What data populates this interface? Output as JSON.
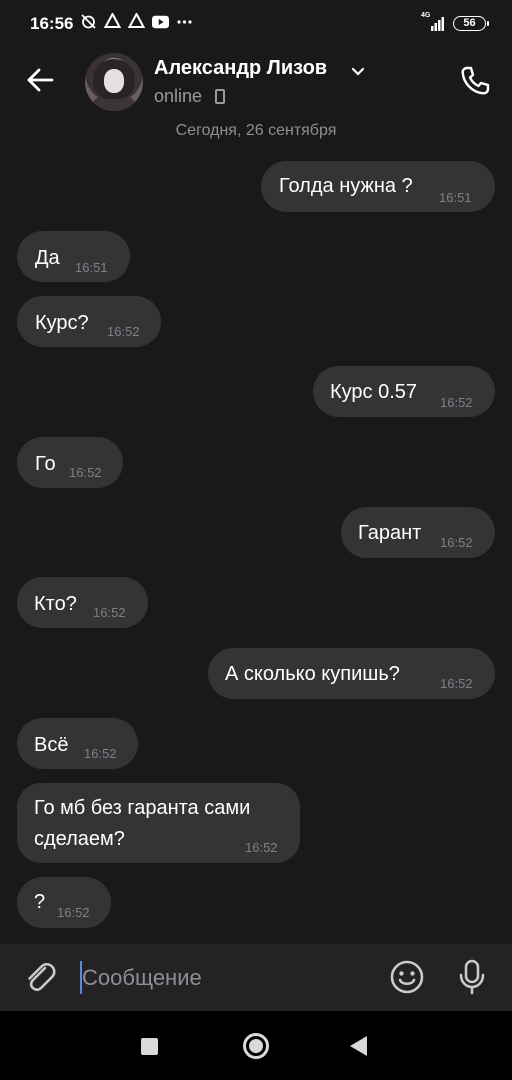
{
  "status_bar": {
    "time": "16:56",
    "network": "4G",
    "battery": "56"
  },
  "header": {
    "back_icon": "back-arrow-icon",
    "contact_name": "Александр Лизов",
    "status": "online",
    "call_icon": "phone-icon"
  },
  "chat": {
    "date_separator": "Сегодня, 26 сентября",
    "messages": [
      {
        "side": "out",
        "text": "Голда нужна ?",
        "time": "16:51"
      },
      {
        "side": "in",
        "text": "Да",
        "time": "16:51"
      },
      {
        "side": "in",
        "text": "Курс?",
        "time": "16:52"
      },
      {
        "side": "out",
        "text": "Курс 0.57",
        "time": "16:52"
      },
      {
        "side": "in",
        "text": "Го",
        "time": "16:52"
      },
      {
        "side": "out",
        "text": "Гарант",
        "time": "16:52"
      },
      {
        "side": "in",
        "text": "Кто?",
        "time": "16:52"
      },
      {
        "side": "out",
        "text": "А сколько купишь?",
        "time": "16:52"
      },
      {
        "side": "in",
        "text": "Всё",
        "time": "16:52"
      },
      {
        "side": "in",
        "text_line1": "Го мб без гаранта сами",
        "text_line2": "сделаем?",
        "time": "16:52"
      },
      {
        "side": "in",
        "text": "?",
        "time": "16:52"
      }
    ]
  },
  "composer": {
    "placeholder": "Сообщение",
    "attach_icon": "paperclip-icon",
    "emoji_icon": "emoji-icon",
    "mic_icon": "microphone-icon"
  },
  "colors": {
    "background": "#19191a",
    "bubble": "#333436",
    "time_text": "#7f8084",
    "secondary_text": "#8e8e93"
  }
}
